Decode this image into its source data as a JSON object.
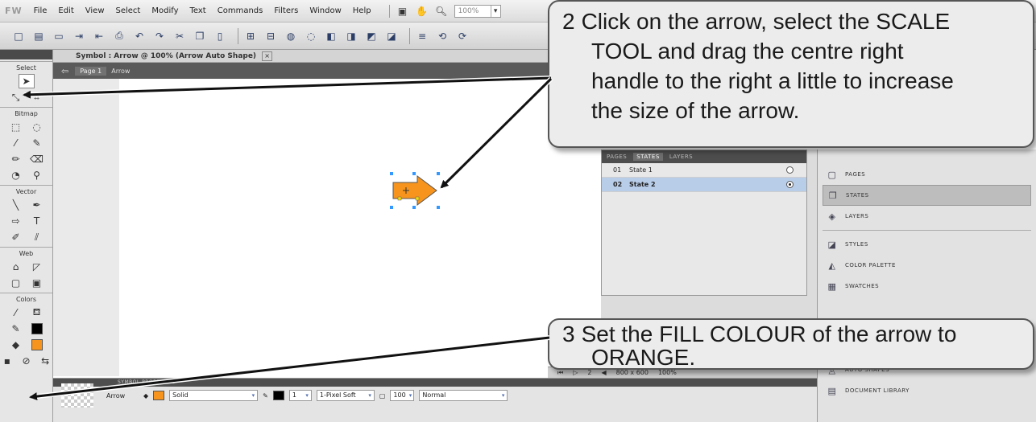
{
  "menubar": {
    "logo": "FW",
    "items": [
      "File",
      "Edit",
      "View",
      "Select",
      "Modify",
      "Text",
      "Commands",
      "Filters",
      "Window",
      "Help"
    ],
    "zoom_value": "100%"
  },
  "document": {
    "title": "Symbol : Arrow @ 100% (Arrow Auto Shape)",
    "close_label": "×",
    "page_crumb": "Page 1",
    "symbol_crumb": "Arrow"
  },
  "tools": {
    "select_label": "Select",
    "bitmap_label": "Bitmap",
    "vector_label": "Vector",
    "web_label": "Web",
    "colors_label": "Colors"
  },
  "states_panel": {
    "tabs": [
      "PAGES",
      "STATES",
      "LAYERS"
    ],
    "active_tab": "STATES",
    "rows": [
      {
        "num": "01",
        "name": "State 1"
      },
      {
        "num": "02",
        "name": "State 2"
      }
    ]
  },
  "dock": {
    "items": [
      "PAGES",
      "STATES",
      "LAYERS",
      "STYLES",
      "COLOR PALETTE",
      "SWATCHES",
      "AUTO SHAPES",
      "DOCUMENT LIBRARY"
    ]
  },
  "statusbar": {
    "page": "2",
    "size": "800 x 600",
    "zoom": "100%"
  },
  "properties": {
    "tab_label": "SYMBOL PROPERTIES",
    "name": "Arrow",
    "fill_type": "Solid",
    "stroke_size": "1",
    "stroke_type": "1-Pixel Soft",
    "opacity": "100",
    "blend": "Normal"
  },
  "colors": {
    "fill": "#f7941d",
    "stroke": "#000000"
  },
  "callouts": {
    "step2_num": "2",
    "step2_text_line1": "Click on the arrow, select the SCALE",
    "step2_text_line2": "TOOL and drag the centre right",
    "step2_text_line3": "handle to the right a little to increase",
    "step2_text_line4": "the size of the arrow.",
    "step3_num": "3",
    "step3_text_line1": "Set the FILL COLOUR of the arrow to",
    "step3_text_line2": "ORANGE."
  }
}
